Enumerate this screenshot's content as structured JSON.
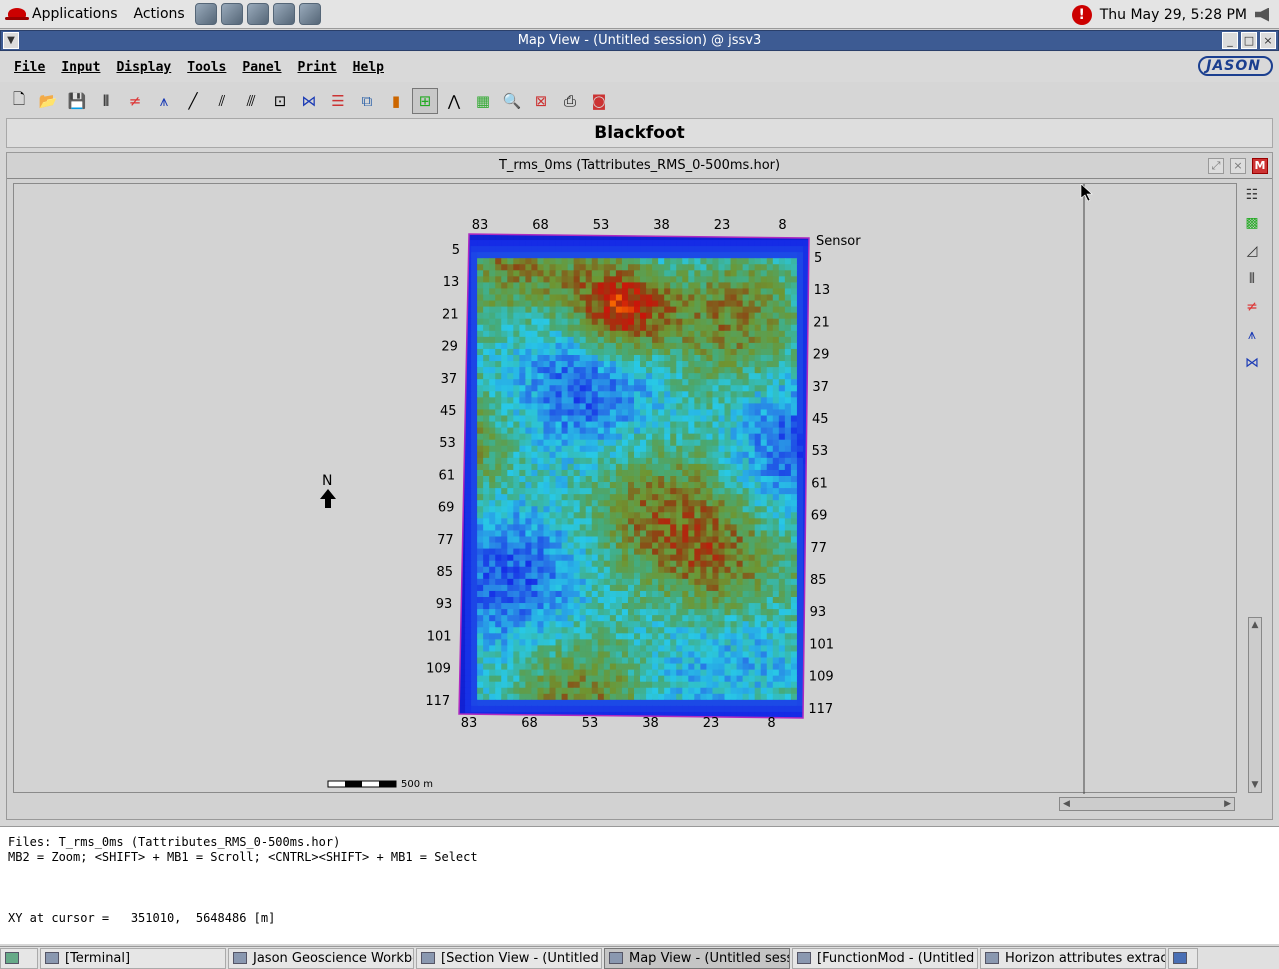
{
  "top_panel": {
    "applications": "Applications",
    "actions": "Actions",
    "clock": "Thu May 29,  5:28 PM"
  },
  "window": {
    "title": "Map View - (Untitled session) @ jssv3"
  },
  "menubar": {
    "file": "File",
    "input": "Input",
    "display": "Display",
    "tools": "Tools",
    "panel": "Panel",
    "print": "Print",
    "help": "Help",
    "logo": "JASON"
  },
  "panel_title": "Blackfoot",
  "map": {
    "header": "T_rms_0ms (Tattributes_RMS_0-500ms.hor)",
    "top_ticks": [
      "83",
      "68",
      "53",
      "38",
      "23",
      "8"
    ],
    "bottom_ticks": [
      "83",
      "68",
      "53",
      "38",
      "23",
      "8"
    ],
    "left_ticks": [
      "5",
      "13",
      "21",
      "29",
      "37",
      "45",
      "53",
      "61",
      "69",
      "77",
      "85",
      "93",
      "101",
      "109",
      "117"
    ],
    "right_ticks": [
      "5",
      "13",
      "21",
      "29",
      "37",
      "45",
      "53",
      "61",
      "69",
      "77",
      "85",
      "93",
      "101",
      "109",
      "117"
    ],
    "sensor_label": "Sensor",
    "north_label": "N",
    "scale_label": "500 m"
  },
  "console": {
    "line1": "Files: T_rms_0ms (Tattributes_RMS_0-500ms.hor)",
    "line2": "MB2 = Zoom; <SHIFT> + MB1 = Scroll; <CNTRL><SHIFT> + MB1 = Select",
    "cursor": "XY at cursor =   351010,  5648486 [m]"
  },
  "taskbar": {
    "tasks": [
      "[Terminal]",
      "Jason Geoscience Workber",
      "[Section View - (Untitled se:",
      "Map View - (Untitled sessio",
      "[FunctionMod - (Untitled trai",
      "Horizon attributes extractior"
    ]
  }
}
